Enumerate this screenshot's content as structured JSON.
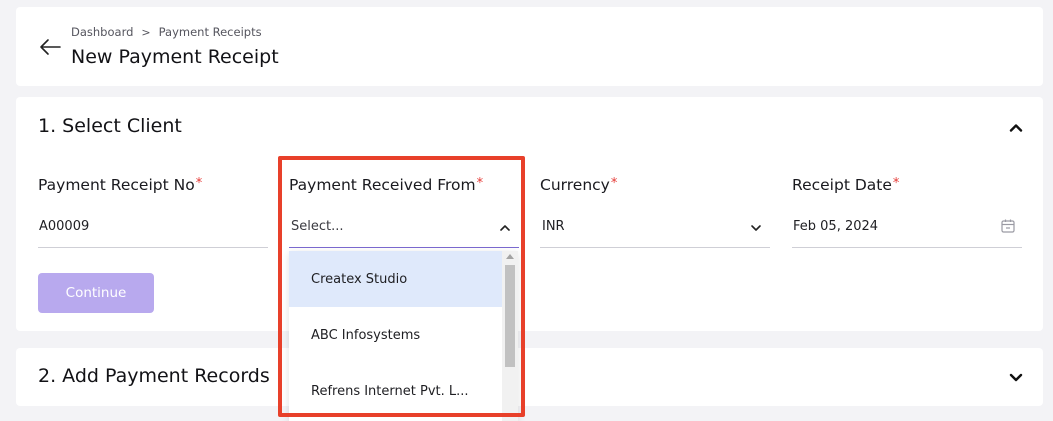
{
  "header": {
    "breadcrumb": [
      "Dashboard",
      "Payment Receipts"
    ],
    "breadcrumb_separator": ">",
    "title": "New Payment Receipt"
  },
  "section1": {
    "title": "1. Select Client",
    "fields": {
      "receipt_no": {
        "label": "Payment Receipt No",
        "required_mark": "*",
        "value": "A00009"
      },
      "received_from": {
        "label": "Payment Received From",
        "required_mark": "*",
        "placeholder": "Select..."
      },
      "currency": {
        "label": "Currency",
        "required_mark": "*",
        "value": "INR"
      },
      "receipt_date": {
        "label": "Receipt Date",
        "required_mark": "*",
        "value": "Feb 05, 2024"
      }
    },
    "continue_label": "Continue"
  },
  "dropdown": {
    "options": [
      "Createx Studio",
      "ABC Infosystems",
      "Refrens Internet Pvt. L..."
    ],
    "highlighted_index": 0
  },
  "section2": {
    "title": "2. Add Payment Records"
  },
  "colors": {
    "accent": "#7b6ad1",
    "button_disabled": "#b8a9ee",
    "required": "#e53935",
    "highlight_annotation": "#e8402a",
    "option_hover": "#dfe9fb"
  },
  "icons": {
    "back": "arrow-left-icon",
    "breadcrumb_sep": "chevron-right-icon",
    "section1_toggle": "chevron-up-icon",
    "section2_toggle": "chevron-down-icon",
    "received_from_select": "chevron-up-icon",
    "currency_select": "chevron-down-icon",
    "date_picker": "calendar-icon"
  }
}
